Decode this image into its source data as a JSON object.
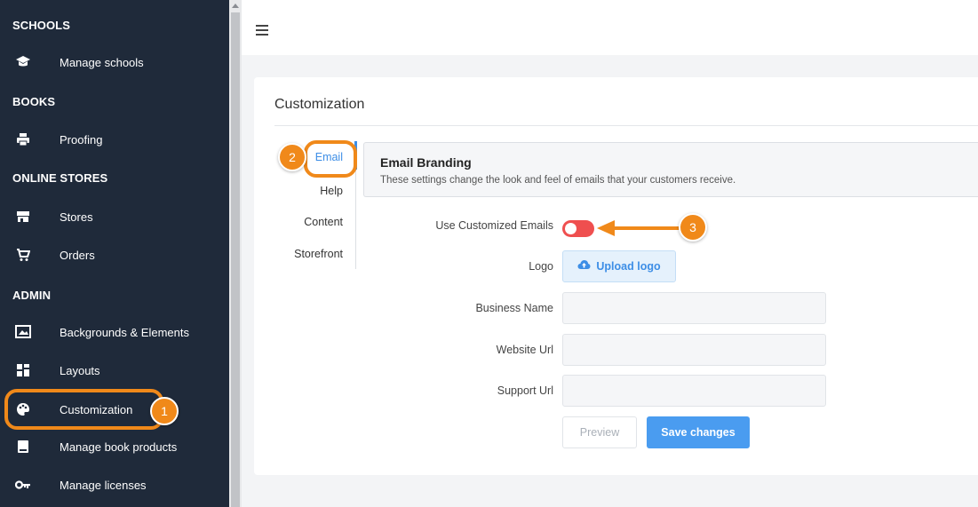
{
  "sidebar": {
    "sections": [
      {
        "title": "SCHOOLS"
      },
      {
        "title": "BOOKS"
      },
      {
        "title": "ONLINE STORES"
      },
      {
        "title": "ADMIN"
      }
    ],
    "items": [
      {
        "label": "Manage schools",
        "icon": "graduation-cap-icon"
      },
      {
        "label": "Proofing",
        "icon": "printer-icon"
      },
      {
        "label": "Stores",
        "icon": "store-icon"
      },
      {
        "label": "Orders",
        "icon": "cart-icon"
      },
      {
        "label": "Backgrounds & Elements",
        "icon": "images-icon"
      },
      {
        "label": "Layouts",
        "icon": "layout-icon"
      },
      {
        "label": "Customization",
        "icon": "palette-icon"
      },
      {
        "label": "Manage book products",
        "icon": "book-icon"
      },
      {
        "label": "Manage licenses",
        "icon": "key-icon"
      }
    ],
    "colors": {
      "background": "#1f2a3a"
    }
  },
  "card": {
    "title": "Customization",
    "tabs": [
      "Email",
      "Help",
      "Content",
      "Storefront"
    ],
    "active_tab": "Email",
    "branding": {
      "heading": "Email Branding",
      "description": "These settings change the look and feel of emails that your customers receive."
    },
    "form": {
      "use_customized_label": "Use Customized Emails",
      "use_customized_value": false,
      "logo_label": "Logo",
      "upload_label": "Upload logo",
      "business_name_label": "Business Name",
      "business_name_value": "",
      "website_url_label": "Website Url",
      "website_url_value": "",
      "support_url_label": "Support Url",
      "support_url_value": "",
      "preview_label": "Preview",
      "save_label": "Save changes"
    }
  },
  "annotations": {
    "badge1": "1",
    "badge2": "2",
    "badge3": "3",
    "color": "#f0891a"
  },
  "colors": {
    "accent": "#4a9cf0",
    "toggle_off": "#ef4f4f"
  }
}
